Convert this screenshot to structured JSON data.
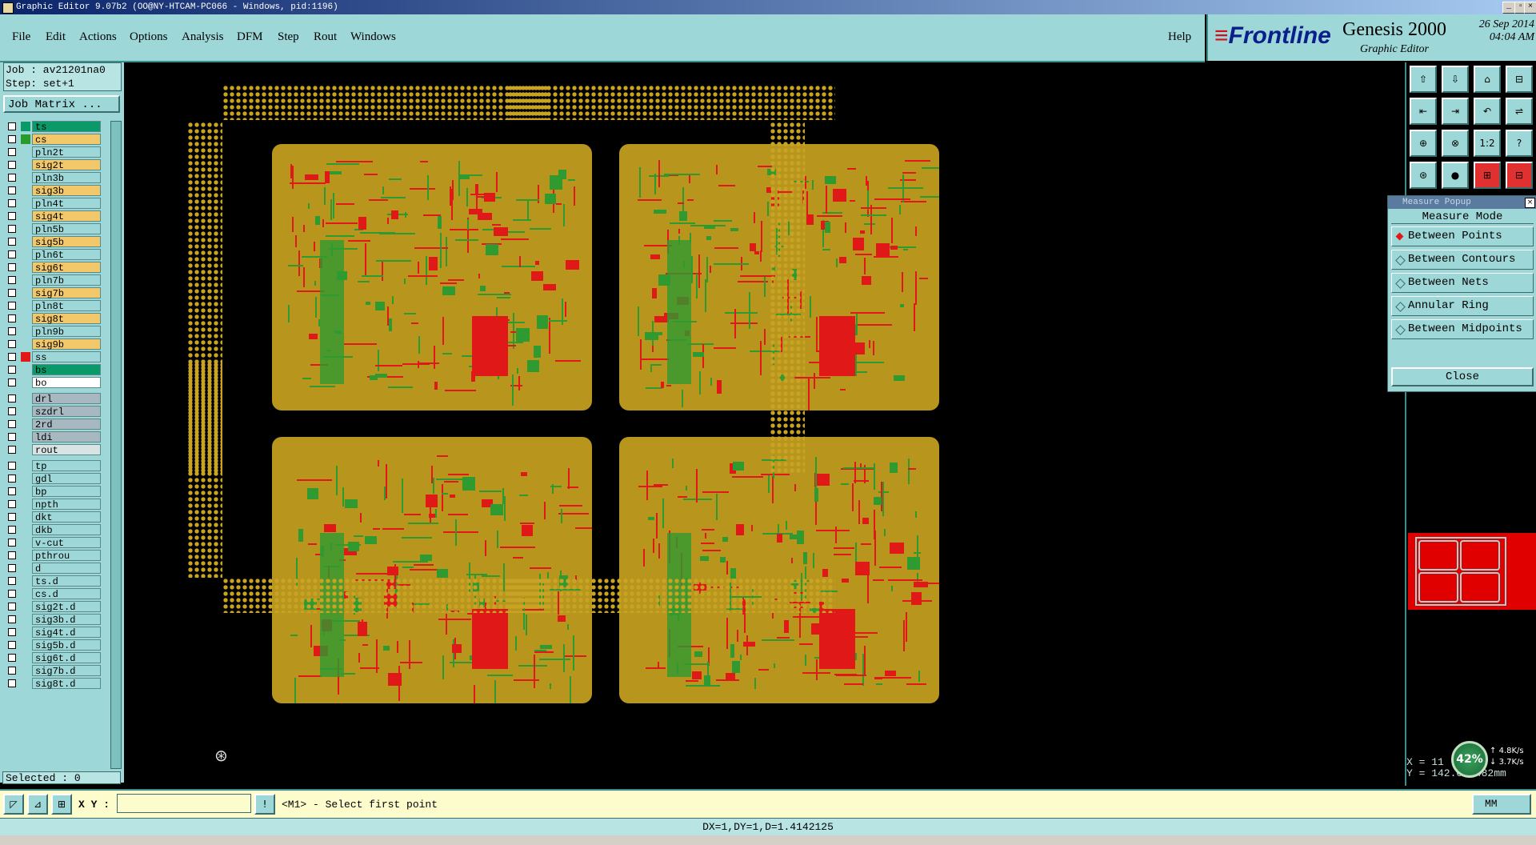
{
  "window": {
    "title": "Graphic Editor 9.07b2 (OO@NY-HTCAM-PC066 - Windows, pid:1196)"
  },
  "menu": [
    "File",
    "Edit",
    "Actions",
    "Options",
    "Analysis",
    "DFM",
    "Step",
    "Rout",
    "Windows"
  ],
  "help_label": "Help",
  "brand": {
    "logo": "Frontline",
    "product": "Genesis 2000",
    "subtitle": "Graphic Editor",
    "date": "26 Sep 2014",
    "time": "04:04 AM"
  },
  "job": {
    "job_line": "Job : av21201na0",
    "step_line": "Step: set+1",
    "matrix_button": "Job Matrix ..."
  },
  "layers": [
    {
      "name": "ts",
      "color": "#0a9a6a",
      "swatch": "#0a9a6a"
    },
    {
      "name": "cs",
      "color": "#f2c86a",
      "swatch": "#2a9a2a"
    },
    {
      "name": "pln2t",
      "color": "#9ed7d7",
      "swatch": "#9ed7d7"
    },
    {
      "name": "sig2t",
      "color": "#f2c86a",
      "swatch": "#9ed7d7"
    },
    {
      "name": "pln3b",
      "color": "#9ed7d7",
      "swatch": "#9ed7d7"
    },
    {
      "name": "sig3b",
      "color": "#f2c86a",
      "swatch": "#9ed7d7"
    },
    {
      "name": "pln4t",
      "color": "#9ed7d7",
      "swatch": "#9ed7d7"
    },
    {
      "name": "sig4t",
      "color": "#f2c86a",
      "swatch": "#9ed7d7"
    },
    {
      "name": "pln5b",
      "color": "#9ed7d7",
      "swatch": "#9ed7d7"
    },
    {
      "name": "sig5b",
      "color": "#f2c86a",
      "swatch": "#9ed7d7"
    },
    {
      "name": "pln6t",
      "color": "#9ed7d7",
      "swatch": "#9ed7d7"
    },
    {
      "name": "sig6t",
      "color": "#f2c86a",
      "swatch": "#9ed7d7"
    },
    {
      "name": "pln7b",
      "color": "#9ed7d7",
      "swatch": "#9ed7d7"
    },
    {
      "name": "sig7b",
      "color": "#f2c86a",
      "swatch": "#9ed7d7"
    },
    {
      "name": "pln8t",
      "color": "#9ed7d7",
      "swatch": "#9ed7d7"
    },
    {
      "name": "sig8t",
      "color": "#f2c86a",
      "swatch": "#9ed7d7"
    },
    {
      "name": "pln9b",
      "color": "#9ed7d7",
      "swatch": "#9ed7d7"
    },
    {
      "name": "sig9b",
      "color": "#f2c86a",
      "swatch": "#9ed7d7"
    },
    {
      "name": "ss",
      "color": "#9ed7d7",
      "swatch": "#e01818"
    },
    {
      "name": "bs",
      "color": "#0a9a6a",
      "swatch": "#9ed7d7"
    },
    {
      "name": "bo",
      "color": "#ffffff",
      "swatch": "#9ed7d7"
    },
    {
      "name": "drl",
      "color": "#a8b8c0",
      "swatch": "#9ed7d7"
    },
    {
      "name": "szdrl",
      "color": "#a8b8c0",
      "swatch": "#9ed7d7"
    },
    {
      "name": "2rd",
      "color": "#a8b8c0",
      "swatch": "#9ed7d7"
    },
    {
      "name": "ldi",
      "color": "#a8b8c0",
      "swatch": "#9ed7d7"
    },
    {
      "name": "rout",
      "color": "#d8e4e4",
      "swatch": "#9ed7d7"
    },
    {
      "name": "tp",
      "color": "#9ed7d7",
      "swatch": "#9ed7d7"
    },
    {
      "name": "gdl",
      "color": "#9ed7d7",
      "swatch": "#9ed7d7"
    },
    {
      "name": "bp",
      "color": "#9ed7d7",
      "swatch": "#9ed7d7"
    },
    {
      "name": "npth",
      "color": "#9ed7d7",
      "swatch": "#9ed7d7"
    },
    {
      "name": "dkt",
      "color": "#9ed7d7",
      "swatch": "#9ed7d7"
    },
    {
      "name": "dkb",
      "color": "#9ed7d7",
      "swatch": "#9ed7d7"
    },
    {
      "name": "v-cut",
      "color": "#9ed7d7",
      "swatch": "#9ed7d7"
    },
    {
      "name": "pthrou",
      "color": "#9ed7d7",
      "swatch": "#9ed7d7"
    },
    {
      "name": "d",
      "color": "#9ed7d7",
      "swatch": "#9ed7d7"
    },
    {
      "name": "ts.d",
      "color": "#9ed7d7",
      "swatch": "#9ed7d7"
    },
    {
      "name": "cs.d",
      "color": "#9ed7d7",
      "swatch": "#9ed7d7"
    },
    {
      "name": "sig2t.d",
      "color": "#9ed7d7",
      "swatch": "#9ed7d7"
    },
    {
      "name": "sig3b.d",
      "color": "#9ed7d7",
      "swatch": "#9ed7d7"
    },
    {
      "name": "sig4t.d",
      "color": "#9ed7d7",
      "swatch": "#9ed7d7"
    },
    {
      "name": "sig5b.d",
      "color": "#9ed7d7",
      "swatch": "#9ed7d7"
    },
    {
      "name": "sig6t.d",
      "color": "#9ed7d7",
      "swatch": "#9ed7d7"
    },
    {
      "name": "sig7b.d",
      "color": "#9ed7d7",
      "swatch": "#9ed7d7"
    },
    {
      "name": "sig8t.d",
      "color": "#9ed7d7",
      "swatch": "#9ed7d7"
    }
  ],
  "selected": "Selected : 0",
  "toolbar_icons": [
    "zoom-home-icon",
    "redraw-icon",
    "home-icon",
    "window-icon",
    "pan-left-icon",
    "pan-right-icon",
    "undo-view-icon",
    "snap-icon",
    "fit-icon",
    "center-icon",
    "scale-icon",
    "help-icon",
    "layer-icon",
    "measure-icon",
    "net-icon",
    "graph-icon"
  ],
  "measure_popup": {
    "title": "Measure Popup",
    "heading": "Measure Mode",
    "options": [
      "Between Points",
      "Between Contours",
      "Between Nets",
      "Annular Ring",
      "Between Midpoints"
    ],
    "active_index": 0,
    "close_label": "Close"
  },
  "coords": {
    "x": "X = 11",
    "y": "Y = 142.038482mm"
  },
  "net": {
    "percent": "42%",
    "up": "4.8K/s",
    "down": "3.7K/s"
  },
  "cmd": {
    "xy_label": "X Y :",
    "xy_value": "",
    "prompt": "<M1> - Select first point",
    "units": "MM"
  },
  "status": "DX=1,DY=1,D=1.4142125",
  "colors": {
    "accent": "#9ed7d7",
    "board": "#b8961e",
    "trace_red": "#e01818",
    "trace_green": "#2f9a2f"
  }
}
